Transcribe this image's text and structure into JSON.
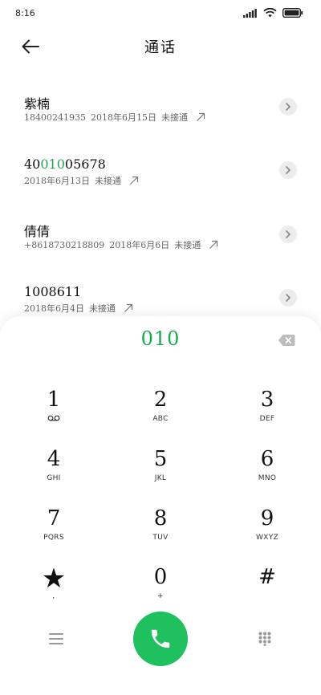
{
  "status_bar": {
    "time": "8:16"
  },
  "header": {
    "title": "通话",
    "back_icon": "arrow-left-icon"
  },
  "calls": [
    {
      "name_parts": [
        "紫楠"
      ],
      "number": "18400241935",
      "date": "2018年6月15日",
      "status": "未接通"
    },
    {
      "name_parts": [
        "40",
        "010",
        "05678"
      ],
      "number": "",
      "date": "2018年6月13日",
      "status": "未接通"
    },
    {
      "name_parts": [
        "倩倩"
      ],
      "number": "+8618730218809",
      "date": "2018年6月6日",
      "status": "未接通"
    },
    {
      "name_parts": [
        "1008611"
      ],
      "number": "",
      "date": "2018年6月4日",
      "status": "未接通"
    }
  ],
  "dialpad": {
    "display": "010",
    "keys": [
      {
        "digit": "1",
        "letters": ""
      },
      {
        "digit": "2",
        "letters": "ABC"
      },
      {
        "digit": "3",
        "letters": "DEF"
      },
      {
        "digit": "4",
        "letters": "GHI"
      },
      {
        "digit": "5",
        "letters": "JKL"
      },
      {
        "digit": "6",
        "letters": "MNO"
      },
      {
        "digit": "7",
        "letters": "PQRS"
      },
      {
        "digit": "8",
        "letters": "TUV"
      },
      {
        "digit": "9",
        "letters": "WXYZ"
      },
      {
        "digit": "★",
        "letters": ","
      },
      {
        "digit": "0",
        "letters": "+"
      },
      {
        "digit": "#",
        "letters": ""
      }
    ]
  },
  "colors": {
    "accent": "#1aaa4f",
    "call_button": "#1fc05e"
  }
}
